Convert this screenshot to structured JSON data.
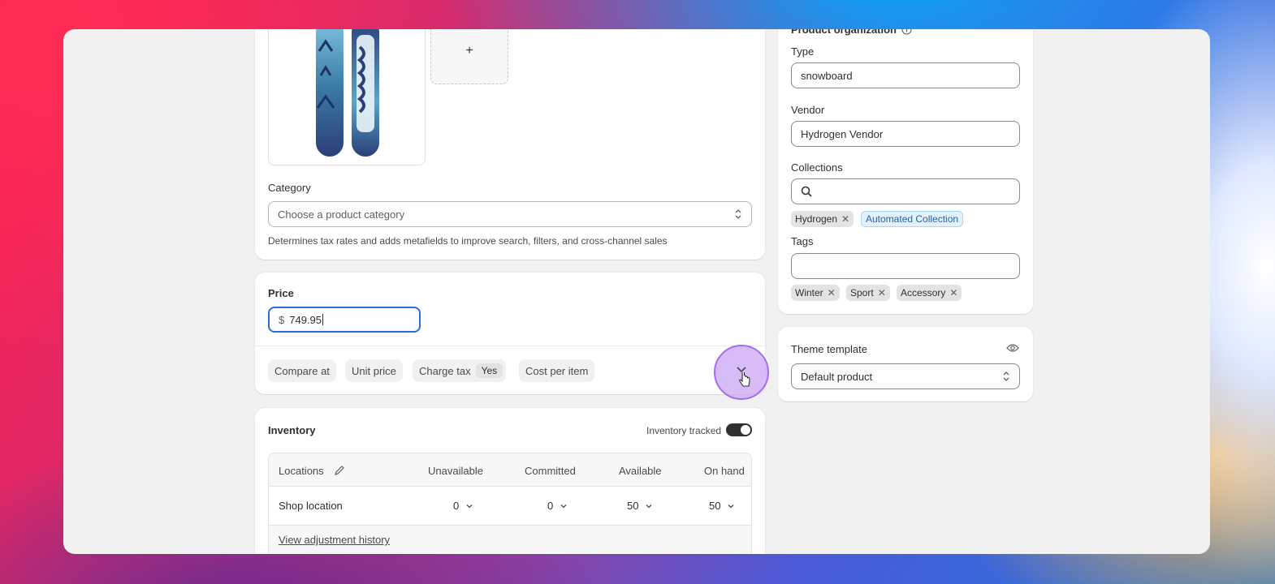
{
  "media": {
    "add_label": "+"
  },
  "category": {
    "label": "Category",
    "placeholder": "Choose a product category",
    "help": "Determines tax rates and adds metafields to improve search, filters, and cross-channel sales"
  },
  "price": {
    "title": "Price",
    "currency": "$",
    "value": "749.95",
    "options": [
      {
        "label": "Compare at"
      },
      {
        "label": "Unit price"
      },
      {
        "label": "Charge tax",
        "badge": "Yes"
      },
      {
        "label": "Cost per item"
      }
    ]
  },
  "inventory": {
    "title": "Inventory",
    "tracked_label": "Inventory tracked",
    "tracked": true,
    "columns": [
      "Locations",
      "Unavailable",
      "Committed",
      "Available",
      "On hand"
    ],
    "rows": [
      {
        "location": "Shop location",
        "unavailable": "0",
        "committed": "0",
        "available": "50",
        "on_hand": "50"
      }
    ],
    "history_link": "View adjustment history"
  },
  "organization": {
    "title": "Product organization",
    "type_label": "Type",
    "type_value": "snowboard",
    "vendor_label": "Vendor",
    "vendor_value": "Hydrogen Vendor",
    "collections_label": "Collections",
    "collections": [
      "Hydrogen",
      "Automated Collection"
    ],
    "tags_label": "Tags",
    "tags": [
      "Winter",
      "Sport",
      "Accessory"
    ]
  },
  "theme": {
    "label": "Theme template",
    "value": "Default product"
  },
  "colors": {
    "focus_ring": "#2c6ecb",
    "cursor_highlight": "#c9a6f5",
    "toggle_on": "#303030"
  }
}
